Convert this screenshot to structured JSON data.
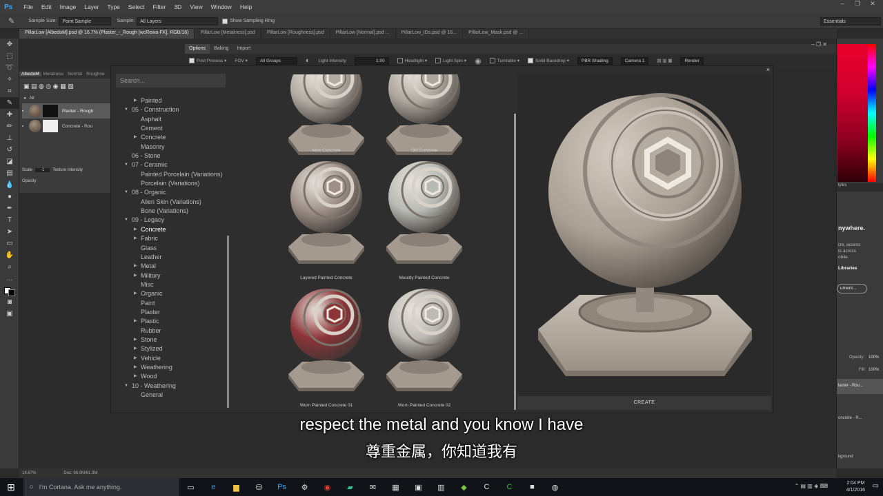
{
  "menubar": {
    "logo": "Ps",
    "items": [
      "File",
      "Edit",
      "Image",
      "Layer",
      "Type",
      "Select",
      "Filter",
      "3D",
      "View",
      "Window",
      "Help"
    ]
  },
  "options": {
    "sample_size_label": "Sample Size:",
    "sample_size_value": "Point Sample",
    "sample_label": "Sample:",
    "sample_value": "All Layers",
    "show_ring_label": "Show Sampling Ring",
    "workspace": "Essentials"
  },
  "doc_tabs": [
    "PillarLow [AlbedoM].psd @ 16.7% (Plaster_-_Rough [wcRewa-FK], RGB/16)",
    "PillarLow [Metalness].psd",
    "PillarLow [Roughness].psd",
    "PillarLow [Normal].psd ...",
    "PillarLow_IDs.psd @ 16...",
    "PillarLow_Mask.psd @ ..."
  ],
  "layers_panel": {
    "tabs": [
      "AlbedoM",
      "Metalness",
      "Normal",
      "Roughne"
    ],
    "filter": "All",
    "rows": [
      "Plaster - Rough",
      "Concrete - Rou"
    ],
    "scale_label": "Scale",
    "scale_value": "-1",
    "texture_label": "Texture Intensity",
    "opacity_label": "Opacity"
  },
  "plugin": {
    "tabs": [
      "Options",
      "Baking",
      "Import"
    ],
    "toolbar": {
      "post_process": "Post Process",
      "fov": "FOV",
      "all_groups": "All Groups",
      "light_intensity_label": "Light Intensity",
      "light_intensity_value": "1.00",
      "headlight": "Headlight",
      "light_spin": "Light Spin",
      "turntable": "Turntable",
      "solid_backdrop": "Solid Backdrop",
      "pbr_shading": "PBR Shading",
      "camera": "Camera 1",
      "render": "Render"
    },
    "search_placeholder": "Search...",
    "tree": [
      {
        "label": "Painted",
        "level": 1,
        "arrow": "right"
      },
      {
        "label": "05 - Construction",
        "level": 0,
        "arrow": "down"
      },
      {
        "label": "Asphalt",
        "level": 1,
        "arrow": ""
      },
      {
        "label": "Cement",
        "level": 1,
        "arrow": ""
      },
      {
        "label": "Concrete",
        "level": 1,
        "arrow": "right"
      },
      {
        "label": "Masonry",
        "level": 1,
        "arrow": ""
      },
      {
        "label": "06 - Stone",
        "level": 0,
        "arrow": ""
      },
      {
        "label": "07 - Ceramic",
        "level": 0,
        "arrow": "down"
      },
      {
        "label": "Painted Porcelain (Variations)",
        "level": 1,
        "arrow": ""
      },
      {
        "label": "Porcelain (Variations)",
        "level": 1,
        "arrow": ""
      },
      {
        "label": "08 - Organic",
        "level": 0,
        "arrow": "down"
      },
      {
        "label": "Alien Skin (Variations)",
        "level": 1,
        "arrow": ""
      },
      {
        "label": "Bone (Variations)",
        "level": 1,
        "arrow": ""
      },
      {
        "label": "09 - Legacy",
        "level": 0,
        "arrow": "down"
      },
      {
        "label": "Concrete",
        "level": 1,
        "arrow": "right",
        "selected": true
      },
      {
        "label": "Fabric",
        "level": 1,
        "arrow": "right"
      },
      {
        "label": "Glass",
        "level": 1,
        "arrow": ""
      },
      {
        "label": "Leather",
        "level": 1,
        "arrow": ""
      },
      {
        "label": "Metal",
        "level": 1,
        "arrow": "right"
      },
      {
        "label": "Military",
        "level": 1,
        "arrow": "right"
      },
      {
        "label": "Misc",
        "level": 1,
        "arrow": ""
      },
      {
        "label": "Organic",
        "level": 1,
        "arrow": "right"
      },
      {
        "label": "Paint",
        "level": 1,
        "arrow": ""
      },
      {
        "label": "Plaster",
        "level": 1,
        "arrow": ""
      },
      {
        "label": "Plastic",
        "level": 1,
        "arrow": "right"
      },
      {
        "label": "Rubber",
        "level": 1,
        "arrow": ""
      },
      {
        "label": "Stone",
        "level": 1,
        "arrow": "right"
      },
      {
        "label": "Stylized",
        "level": 1,
        "arrow": "right"
      },
      {
        "label": "Vehicle",
        "level": 1,
        "arrow": "right"
      },
      {
        "label": "Weathering",
        "level": 1,
        "arrow": "right"
      },
      {
        "label": "Wood",
        "level": 1,
        "arrow": "right"
      },
      {
        "label": "10 - Weathering",
        "level": 0,
        "arrow": "down"
      },
      {
        "label": "General",
        "level": 1,
        "arrow": ""
      }
    ],
    "materials": [
      {
        "label": "New Concrete",
        "tint": "#b3aca4"
      },
      {
        "label": "Old Concrete",
        "tint": "#aca69e"
      },
      {
        "label": "Layered Painted Concrete",
        "tint": "#9e9088"
      },
      {
        "label": "Mouldy Painted Concrete",
        "tint": "#b8bab5"
      },
      {
        "label": "Worn Painted Concrete 01",
        "tint": "#8c3438"
      },
      {
        "label": "Worn Painted Concrete 02",
        "tint": "#bdbab5"
      }
    ],
    "create_label": "CREATE"
  },
  "subtitles": {
    "en": "respect the metal and you know I have",
    "zh": "尊重金属，你知道我有"
  },
  "status": {
    "zoom": "16.67%",
    "doc": "Doc: 96.0M/61.3M"
  },
  "right_panel": {
    "text1": "nywhere.",
    "text2": "ize, access",
    "text3": "ts across",
    "text4": "obile.",
    "link": "Libraries",
    "button": "ument...",
    "opacity_label": "Opacity:",
    "opacity_value": "100%",
    "fill_label": "Fill:",
    "fill_value": "100%",
    "layer1": "laster - Rou...",
    "layer2": "oncrete - R...",
    "bg": "kground"
  },
  "taskbar": {
    "cortana": "I'm Cortana. Ask me anything.",
    "time": "2:04 PM",
    "date": "4/1/2016"
  }
}
